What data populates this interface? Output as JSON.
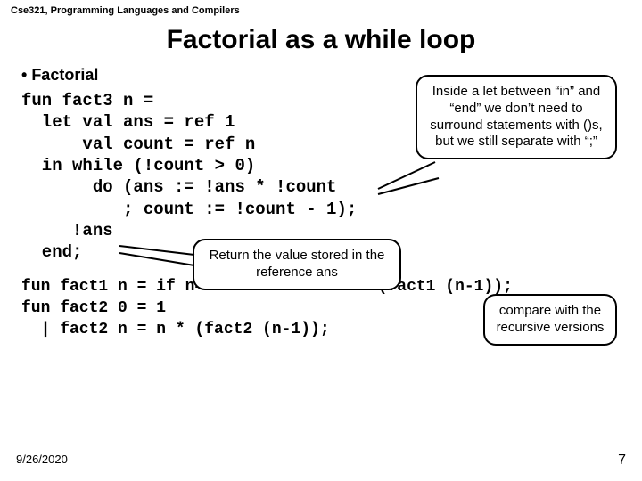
{
  "header": "Cse321, Programming Languages and Compilers",
  "title": "Factorial as a while loop",
  "bullet": "Factorial",
  "code_main": "fun fact3 n =\n  let val ans = ref 1\n      val count = ref n\n  in while (!count > 0)\n       do (ans := !ans * !count\n          ; count := !count - 1);\n     !ans\n  end;",
  "code_compare": "fun fact1 n = if n=0 then 1 else n * (fact1 (n-1));\nfun fact2 0 = 1\n  | fact2 n = n * (fact2 (n-1));",
  "callouts": {
    "inside_let": "Inside a let between “in” and “end” we don’t need to surround statements with ()s, but we still separate with “;”",
    "return_value": "Return the value stored in the reference ans",
    "compare": "compare with the recursive versions"
  },
  "footer": {
    "date": "9/26/2020",
    "page": "7"
  }
}
